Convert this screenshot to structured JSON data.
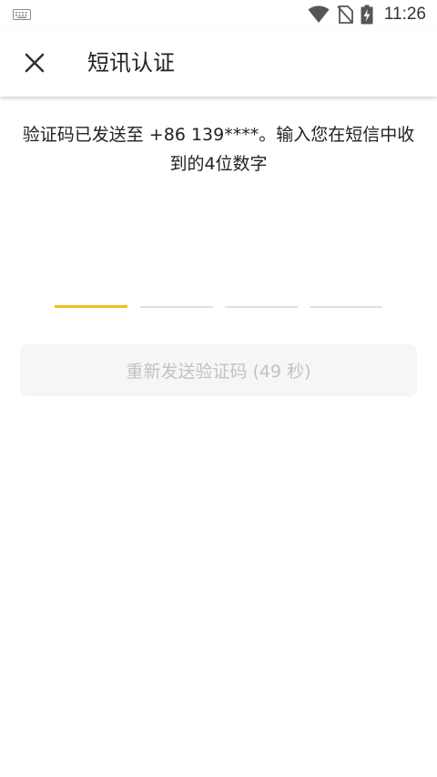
{
  "status_bar": {
    "time": "11:26",
    "icons": [
      "keyboard-icon",
      "wifi-icon",
      "no-sim-icon",
      "battery-charging-icon"
    ]
  },
  "app_bar": {
    "title": "短讯认证",
    "close_icon": "close-icon"
  },
  "verification": {
    "message": "验证码已发送至 +86 139****。输入您在短信中收到的4位数字",
    "code_length": 4,
    "active_slot": 1,
    "active_color": "#f0c020",
    "resend_label": "重新发送验证码 (49 秒)"
  }
}
